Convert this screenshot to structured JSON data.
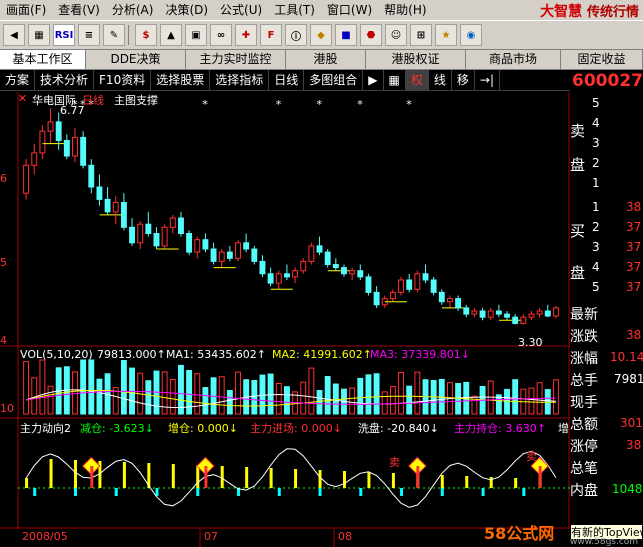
{
  "menubar": {
    "items": [
      "画面(F)",
      "查看(V)",
      "分析(A)",
      "决策(D)",
      "公式(U)",
      "工具(T)",
      "窗口(W)",
      "帮助(H)"
    ],
    "brand": "大智慧",
    "brand_sub": "传统行情"
  },
  "toolbar": {
    "buttons": [
      "RSI",
      "$",
      "F"
    ]
  },
  "tabs": [
    "基本工作区",
    "DDE决策",
    "主力实时监控",
    "港股",
    "港股权证",
    "商品市场",
    "固定收益"
  ],
  "funcbar": {
    "items": [
      "方案",
      "技术分析",
      "F10资料",
      "选择股票",
      "选择指标",
      "日线",
      "多图组合",
      "权",
      "线",
      "移"
    ]
  },
  "stock": {
    "code": "600027",
    "name": "华电国际",
    "period": "日线",
    "main_chart_label": "主图支撑",
    "high_label": "6.77",
    "low_label": "3.30"
  },
  "price_axis": [
    "6",
    "5",
    "4"
  ],
  "volume_panel": {
    "label": "VOL(5,10,20)",
    "value": "79813.000↑",
    "ma1": "MA1: 53435.602↑",
    "ma2": "MA2: 41991.602↑",
    "ma3": "MA3: 37339.801↓",
    "axis": "10"
  },
  "indicator_panel": {
    "label": "主力动向2",
    "jiancang": "减仓: -3.623↓",
    "zengcang": "增仓: 0.000↓",
    "jinchang": "主力进场: 0.000↓",
    "xipan": "洗盘: -20.840↓",
    "chicang": "主力持仓: 3.630↑",
    "tail": "增",
    "mark_label": "卖"
  },
  "dates": [
    "2008/05",
    "07",
    "08"
  ],
  "right_panel": {
    "sell_label": "卖",
    "sell_label2": "盘",
    "buy_label": "买",
    "buy_label2": "盘",
    "rows": [
      "最新",
      "涨跌",
      "涨幅",
      "总手",
      "现手",
      "总额",
      "涨停",
      "总笔",
      "内盘"
    ],
    "sell_numbers": [
      "5",
      "4",
      "3",
      "2",
      "1"
    ],
    "buy_numbers": [
      "1",
      "2",
      "3",
      "4",
      "5"
    ],
    "buy_prices": [
      "38",
      "37",
      "37",
      "37",
      "37"
    ],
    "values": [
      "38",
      "10.14",
      "7981",
      "301",
      "38",
      "1048"
    ]
  },
  "tooltip": "有新的TopView",
  "watermark": "58公式网",
  "watermark_url": "www.58gs.com",
  "colors": {
    "up": "#ff3030",
    "down": "#54fcfc",
    "ma1": "#ffffff",
    "ma2": "#ffff00",
    "ma3": "#ff00ff"
  },
  "chart_data": {
    "type": "candlestick",
    "title": "华电国际 日线",
    "ylim": [
      3.0,
      7.0
    ],
    "y_ticks": [
      4,
      5,
      6
    ],
    "candles": [
      {
        "o": 5.4,
        "h": 5.95,
        "l": 5.3,
        "c": 5.85
      },
      {
        "o": 5.85,
        "h": 6.2,
        "l": 5.7,
        "c": 6.05
      },
      {
        "o": 6.05,
        "h": 6.5,
        "l": 5.95,
        "c": 6.4
      },
      {
        "o": 6.4,
        "h": 6.77,
        "l": 6.2,
        "c": 6.55
      },
      {
        "o": 6.55,
        "h": 6.7,
        "l": 6.1,
        "c": 6.25
      },
      {
        "o": 6.25,
        "h": 6.35,
        "l": 5.95,
        "c": 6.0
      },
      {
        "o": 6.0,
        "h": 6.45,
        "l": 5.9,
        "c": 6.3
      },
      {
        "o": 6.3,
        "h": 6.4,
        "l": 5.8,
        "c": 5.85
      },
      {
        "o": 5.85,
        "h": 5.95,
        "l": 5.4,
        "c": 5.5
      },
      {
        "o": 5.5,
        "h": 5.7,
        "l": 5.2,
        "c": 5.3
      },
      {
        "o": 5.3,
        "h": 5.5,
        "l": 5.05,
        "c": 5.1
      },
      {
        "o": 5.1,
        "h": 5.35,
        "l": 4.9,
        "c": 5.25
      },
      {
        "o": 5.25,
        "h": 5.4,
        "l": 4.8,
        "c": 4.85
      },
      {
        "o": 4.85,
        "h": 5.0,
        "l": 4.55,
        "c": 4.6
      },
      {
        "o": 4.6,
        "h": 4.95,
        "l": 4.5,
        "c": 4.9
      },
      {
        "o": 4.9,
        "h": 5.1,
        "l": 4.7,
        "c": 4.75
      },
      {
        "o": 4.75,
        "h": 4.85,
        "l": 4.5,
        "c": 4.55
      },
      {
        "o": 4.55,
        "h": 4.9,
        "l": 4.5,
        "c": 4.85
      },
      {
        "o": 4.85,
        "h": 5.05,
        "l": 4.75,
        "c": 5.0
      },
      {
        "o": 5.0,
        "h": 5.1,
        "l": 4.7,
        "c": 4.75
      },
      {
        "o": 4.75,
        "h": 4.8,
        "l": 4.4,
        "c": 4.45
      },
      {
        "o": 4.45,
        "h": 4.7,
        "l": 4.35,
        "c": 4.65
      },
      {
        "o": 4.65,
        "h": 4.75,
        "l": 4.45,
        "c": 4.5
      },
      {
        "o": 4.5,
        "h": 4.6,
        "l": 4.25,
        "c": 4.3
      },
      {
        "o": 4.3,
        "h": 4.5,
        "l": 4.2,
        "c": 4.45
      },
      {
        "o": 4.45,
        "h": 4.55,
        "l": 4.3,
        "c": 4.35
      },
      {
        "o": 4.35,
        "h": 4.65,
        "l": 4.3,
        "c": 4.6
      },
      {
        "o": 4.6,
        "h": 4.75,
        "l": 4.45,
        "c": 4.5
      },
      {
        "o": 4.5,
        "h": 4.55,
        "l": 4.25,
        "c": 4.3
      },
      {
        "o": 4.3,
        "h": 4.4,
        "l": 4.05,
        "c": 4.1
      },
      {
        "o": 4.1,
        "h": 4.2,
        "l": 3.9,
        "c": 3.95
      },
      {
        "o": 3.95,
        "h": 4.15,
        "l": 3.85,
        "c": 4.1
      },
      {
        "o": 4.1,
        "h": 4.25,
        "l": 4.0,
        "c": 4.05
      },
      {
        "o": 4.05,
        "h": 4.2,
        "l": 3.95,
        "c": 4.15
      },
      {
        "o": 4.15,
        "h": 4.35,
        "l": 4.1,
        "c": 4.3
      },
      {
        "o": 4.3,
        "h": 4.6,
        "l": 4.25,
        "c": 4.55
      },
      {
        "o": 4.55,
        "h": 4.7,
        "l": 4.4,
        "c": 4.45
      },
      {
        "o": 4.45,
        "h": 4.5,
        "l": 4.2,
        "c": 4.25
      },
      {
        "o": 4.25,
        "h": 4.35,
        "l": 4.15,
        "c": 4.2
      },
      {
        "o": 4.2,
        "h": 4.25,
        "l": 4.05,
        "c": 4.1
      },
      {
        "o": 4.1,
        "h": 4.2,
        "l": 4.0,
        "c": 4.15
      },
      {
        "o": 4.15,
        "h": 4.25,
        "l": 4.0,
        "c": 4.05
      },
      {
        "o": 4.05,
        "h": 4.1,
        "l": 3.75,
        "c": 3.8
      },
      {
        "o": 3.8,
        "h": 3.9,
        "l": 3.55,
        "c": 3.6
      },
      {
        "o": 3.6,
        "h": 3.75,
        "l": 3.55,
        "c": 3.7
      },
      {
        "o": 3.7,
        "h": 3.85,
        "l": 3.65,
        "c": 3.8
      },
      {
        "o": 3.8,
        "h": 4.05,
        "l": 3.75,
        "c": 4.0
      },
      {
        "o": 4.0,
        "h": 4.1,
        "l": 3.8,
        "c": 3.85
      },
      {
        "o": 3.85,
        "h": 4.15,
        "l": 3.8,
        "c": 4.1
      },
      {
        "o": 4.1,
        "h": 4.25,
        "l": 3.95,
        "c": 4.0
      },
      {
        "o": 4.0,
        "h": 4.05,
        "l": 3.75,
        "c": 3.8
      },
      {
        "o": 3.8,
        "h": 3.85,
        "l": 3.6,
        "c": 3.65
      },
      {
        "o": 3.65,
        "h": 3.75,
        "l": 3.55,
        "c": 3.7
      },
      {
        "o": 3.7,
        "h": 3.75,
        "l": 3.5,
        "c": 3.55
      },
      {
        "o": 3.55,
        "h": 3.6,
        "l": 3.4,
        "c": 3.45
      },
      {
        "o": 3.45,
        "h": 3.55,
        "l": 3.4,
        "c": 3.5
      },
      {
        "o": 3.5,
        "h": 3.55,
        "l": 3.35,
        "c": 3.4
      },
      {
        "o": 3.4,
        "h": 3.55,
        "l": 3.35,
        "c": 3.5
      },
      {
        "o": 3.5,
        "h": 3.6,
        "l": 3.4,
        "c": 3.45
      },
      {
        "o": 3.45,
        "h": 3.5,
        "l": 3.35,
        "c": 3.4
      },
      {
        "o": 3.4,
        "h": 3.45,
        "l": 3.28,
        "c": 3.3
      },
      {
        "o": 3.3,
        "h": 3.45,
        "l": 3.28,
        "c": 3.4
      },
      {
        "o": 3.4,
        "h": 3.5,
        "l": 3.35,
        "c": 3.45
      },
      {
        "o": 3.45,
        "h": 3.55,
        "l": 3.4,
        "c": 3.5
      },
      {
        "o": 3.5,
        "h": 3.6,
        "l": 3.4,
        "c": 3.42
      },
      {
        "o": 3.42,
        "h": 3.58,
        "l": 3.38,
        "c": 3.55
      }
    ]
  }
}
